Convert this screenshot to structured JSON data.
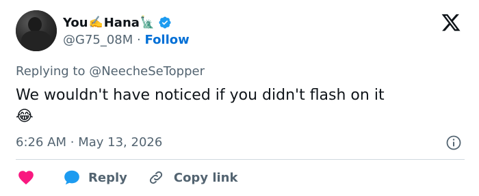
{
  "author": {
    "name_part1": "You",
    "name_emoji1": "✍️",
    "name_part2": "Hana",
    "name_emoji2": "🗽",
    "verified": true,
    "handle": "@G75_08M",
    "separator": "·",
    "follow_label": "Follow"
  },
  "reply_context": {
    "prefix": "Replying to",
    "mention": "@NeecheSeTopper"
  },
  "tweet": {
    "text": "We wouldn't have noticed if you didn't flash on it",
    "emoji": "😂"
  },
  "meta": {
    "time": "6:26 AM",
    "separator": "·",
    "date": "May 13, 2026"
  },
  "actions": {
    "reply_label": "Reply",
    "copy_link_label": "Copy link"
  },
  "icons": {
    "logo": "x-logo-icon",
    "verified": "verified-badge-icon",
    "info": "info-icon",
    "like": "heart-icon",
    "reply": "speech-bubble-icon",
    "copy": "link-icon"
  },
  "colors": {
    "text": "#0f1419",
    "secondary": "#536471",
    "link": "#006fd6",
    "verified": "#1d9bf0",
    "like": "#f91880",
    "reply": "#1d9bf0",
    "divider": "#cfd9de"
  }
}
